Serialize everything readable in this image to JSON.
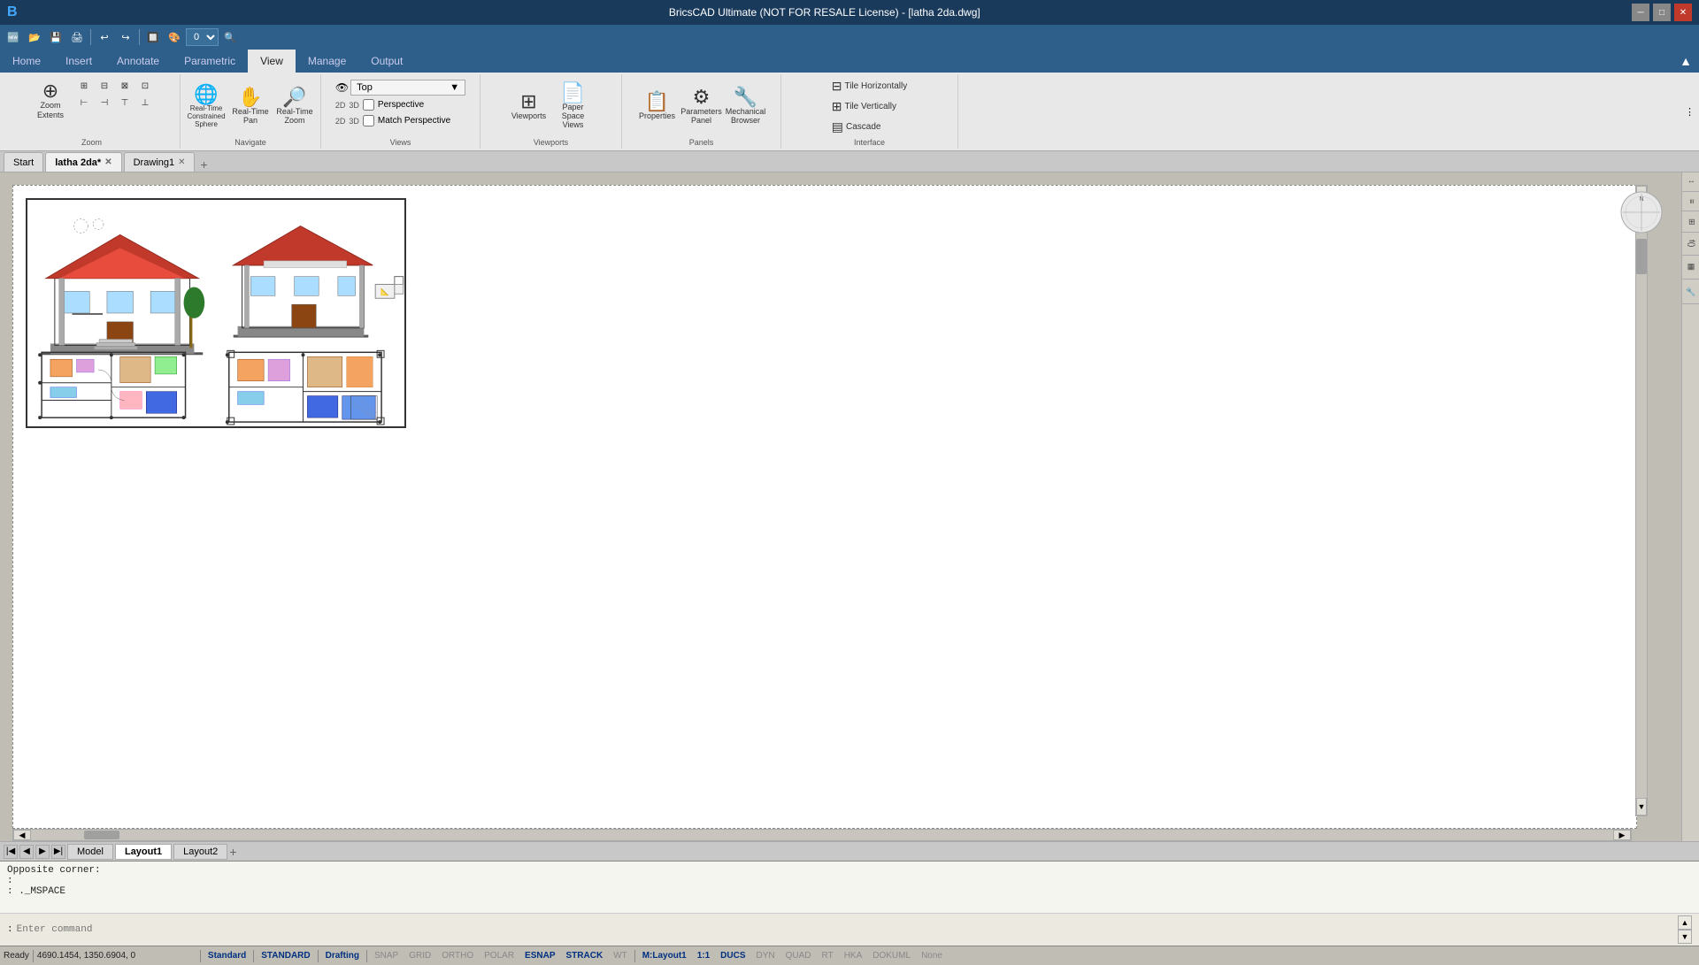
{
  "titlebar": {
    "title": "BricsCAD Ultimate (NOT FOR RESALE License) - [latha 2da.dwg]",
    "minimize": "─",
    "maximize": "□",
    "close": "✕"
  },
  "quickaccess": {
    "buttons": [
      "🆕",
      "📂",
      "💾",
      "🖨",
      "↩",
      "↪"
    ],
    "dropdown_value": "0"
  },
  "ribbon": {
    "tabs": [
      "Home",
      "Insert",
      "Annotate",
      "Parametric",
      "View",
      "Manage",
      "Output"
    ],
    "active_tab": "View",
    "groups": {
      "zoom": {
        "label": "Zoom",
        "buttons": [
          {
            "label": "Zoom\nExtents",
            "icon": "⊕"
          },
          {
            "label": "Real-Time\nConstrained Sphere",
            "icon": "🔍"
          },
          {
            "label": "Real-Time\nPan",
            "icon": "✋"
          },
          {
            "label": "Real-Time\nZoom",
            "icon": "🔎"
          }
        ],
        "mini_buttons": [
          "⊞",
          "⊟",
          "⊠",
          "⊡",
          "⊢",
          "⊣",
          "⊤",
          "⊥"
        ]
      },
      "navigate": {
        "label": "Navigate"
      },
      "views": {
        "label": "Views",
        "dropdown": "Top",
        "rows": [
          {
            "icons": [
              "2D",
              "3D"
            ],
            "label": "Perspective",
            "checkbox": true,
            "checked": false
          },
          {
            "icons": [
              "2D",
              "3D"
            ],
            "label": "Match Perspective",
            "checkbox": true,
            "checked": false
          }
        ]
      },
      "viewports": {
        "label": "Viewports",
        "buttons": [
          {
            "label": "Viewports",
            "icon": "⊞"
          },
          {
            "label": "Paper Space\nViews",
            "icon": "📄"
          }
        ]
      },
      "panels": {
        "label": "Panels",
        "buttons": [
          {
            "label": "Properties",
            "icon": "📋"
          },
          {
            "label": "Parameters\nPanel",
            "icon": "⚙"
          },
          {
            "label": "Mechanical\nBrowser",
            "icon": "🔧"
          }
        ]
      },
      "interface": {
        "label": "Interface",
        "items": [
          "Tile Horizontally",
          "Tile Vertically",
          "Cascade"
        ]
      }
    }
  },
  "tabs": {
    "items": [
      {
        "label": "Start",
        "closable": false
      },
      {
        "label": "latha 2da*",
        "closable": true,
        "active": true
      },
      {
        "label": "Drawing1",
        "closable": true
      }
    ]
  },
  "layout_tabs": {
    "items": [
      {
        "label": "Model"
      },
      {
        "label": "Layout1",
        "active": true
      },
      {
        "label": "Layout2"
      }
    ]
  },
  "command": {
    "lines": [
      "Opposite corner:",
      ":",
      ": ._MSPACE"
    ],
    "prompt": ":",
    "input_placeholder": "Enter command"
  },
  "statusbar": {
    "ready": "Ready",
    "coords": "4690.1454, 1350.6904, 0",
    "items": [
      {
        "label": "Standard",
        "active": true
      },
      {
        "label": "STANDARD",
        "active": true
      },
      {
        "label": "Drafting",
        "active": true
      },
      {
        "label": "SNAP",
        "active": false
      },
      {
        "label": "GRID",
        "active": false
      },
      {
        "label": "ORTHO",
        "active": false
      },
      {
        "label": "POLAR",
        "active": false
      },
      {
        "label": "ESNAP",
        "active": true
      },
      {
        "label": "STRACK",
        "active": true
      },
      {
        "label": "WT",
        "active": false
      },
      {
        "label": "M:Layout1",
        "active": true
      },
      {
        "label": "1:1",
        "active": true
      },
      {
        "label": "DUCS",
        "active": true
      },
      {
        "label": "DYN",
        "active": false
      },
      {
        "label": "QUAD",
        "active": false
      },
      {
        "label": "RT",
        "active": false
      },
      {
        "label": "HKA",
        "active": false
      },
      {
        "label": "DOKUML",
        "active": false
      },
      {
        "label": "None",
        "active": false
      }
    ]
  },
  "right_panels": [
    "↕",
    "≡",
    "⊞",
    "f(x)",
    "▦",
    "🔧"
  ],
  "compass": "○"
}
